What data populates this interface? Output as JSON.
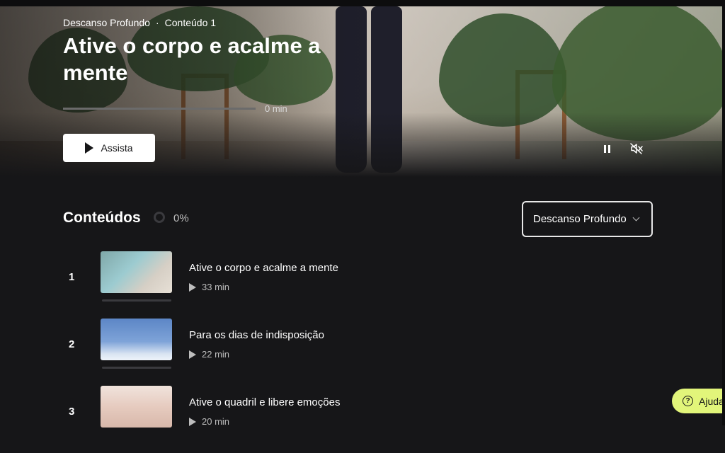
{
  "hero": {
    "breadcrumb_program": "Descanso Profundo",
    "breadcrumb_sep": "·",
    "breadcrumb_item": "Conteúdo 1",
    "title": "Ative o corpo e acalme a mente",
    "progress_label": "0 min",
    "progress": 0,
    "watch_label": "Assista"
  },
  "contents": {
    "heading": "Conteúdos",
    "percent": "0%",
    "program_select": "Descanso Profundo",
    "items": [
      {
        "number": "1",
        "title": "Ative o corpo e acalme a mente",
        "duration": "33 min"
      },
      {
        "number": "2",
        "title": "Para os dias de indisposição",
        "duration": "22 min"
      },
      {
        "number": "3",
        "title": "Ative o quadril e libere emoções",
        "duration": "20 min"
      }
    ]
  },
  "help": {
    "label": "Ajuda"
  },
  "colors": {
    "background": "#161618",
    "accent": "#e2f57a"
  }
}
